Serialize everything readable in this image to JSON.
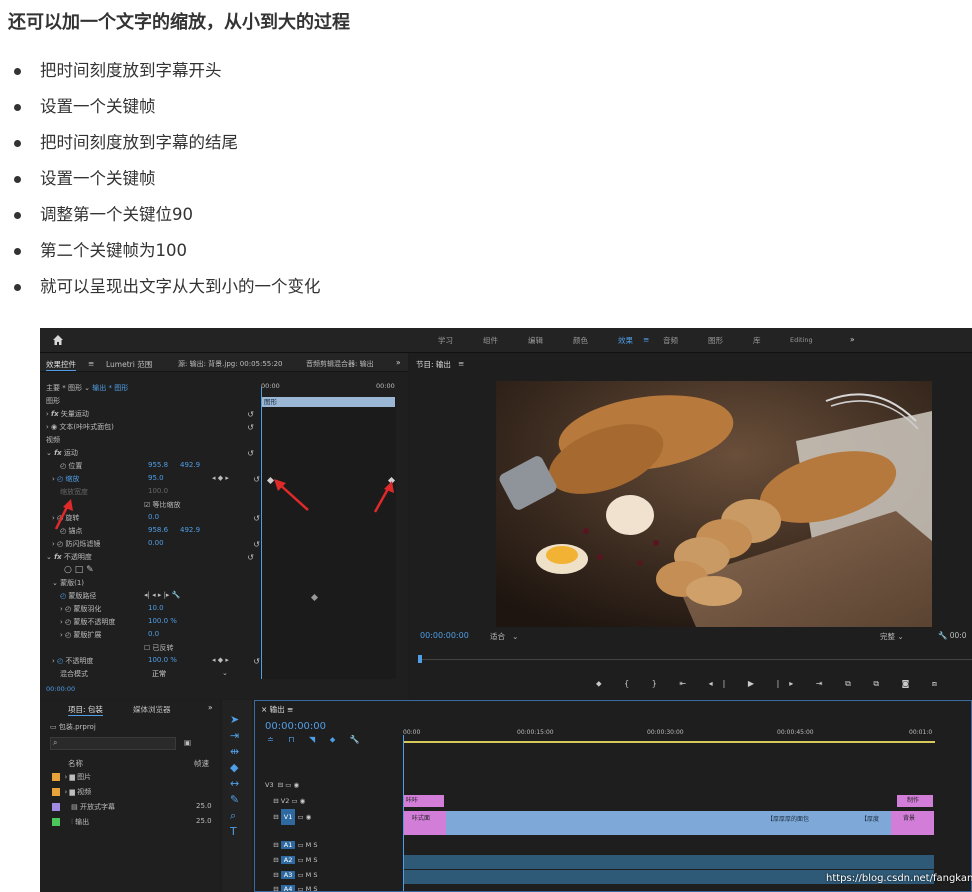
{
  "heading": "还可以加一个文字的缩放，从小到大的过程",
  "bullets": [
    "把时间刻度放到字幕开头",
    "设置一个关键帧",
    "把时间刻度放到字幕的结尾",
    "设置一个关键帧",
    "调整第一个关键位90",
    "第二个关键帧为100",
    "就可以呈现出文字从大到小的一个变化"
  ],
  "premiere": {
    "workspaces": [
      "学习",
      "组件",
      "编辑",
      "颜色",
      "效果",
      "音频",
      "图形",
      "库",
      "Editing"
    ],
    "active_workspace": "效果",
    "more": "»",
    "effect_controls": {
      "tabs": [
        "效果控件",
        "Lumetri 范围",
        "源: 输出: 背景.jpg: 00:05:55:20",
        "音频剪辑混合器: 输出"
      ],
      "source_label": "主要 * 图形",
      "seq_label": "输出 * 图形",
      "ruler_start": "00:00",
      "ruler_end": "00:00",
      "clip_label": "图形",
      "rows": [
        {
          "label": "图形"
        },
        {
          "label": "矢量运动"
        },
        {
          "label": "文本(咔咔式面包)"
        },
        {
          "label": "视频"
        },
        {
          "label": "运动"
        },
        {
          "label": "位置",
          "v1": "955.8",
          "v2": "492.9"
        },
        {
          "label": "缩放",
          "v1": "95.0"
        },
        {
          "label": "缩放宽度",
          "v1": "100.0"
        },
        {
          "label": "等比缩放"
        },
        {
          "label": "旋转",
          "v1": "0.0"
        },
        {
          "label": "锚点",
          "v1": "958.6",
          "v2": "492.9"
        },
        {
          "label": "防闪烁滤镜",
          "v1": "0.00"
        },
        {
          "label": "不透明度"
        },
        {
          "label": "蒙版(1)"
        },
        {
          "label": "蒙版路径"
        },
        {
          "label": "蒙版羽化",
          "v1": "10.0"
        },
        {
          "label": "蒙版不透明度",
          "v1": "100.0 %"
        },
        {
          "label": "蒙版扩展",
          "v1": "0.0"
        },
        {
          "label": "已反转"
        },
        {
          "label": "不透明度",
          "v1": "100.0 %"
        },
        {
          "label": "混合模式",
          "v1": "正常"
        }
      ],
      "timecode": "00:00:00"
    },
    "program": {
      "title": "节目: 输出",
      "timecode": "00:00:00:00",
      "fit": "适合",
      "quality": "完整",
      "end_tc": "00:0"
    },
    "project": {
      "tabs": [
        "项目: 包装",
        "媒体浏览器"
      ],
      "file": "包装.prproj",
      "col_name": "名称",
      "col_rate": "帧速",
      "items": [
        {
          "name": "图片",
          "color": "#e8a23a",
          "rate": ""
        },
        {
          "name": "视频",
          "color": "#e8a23a",
          "rate": ""
        },
        {
          "name": "开放式字幕",
          "color": "#9f8be0",
          "rate": "25.0"
        },
        {
          "name": "输出",
          "color": "#4cc65a",
          "rate": "25.0"
        }
      ]
    },
    "timeline": {
      "title": "输出",
      "timecode": "00:00:00:00",
      "ruler": [
        "00:00",
        "00:00:15:00",
        "00:00:30:00",
        "00:00:45:00",
        "00:01:0"
      ],
      "tracks": [
        "V3",
        "V2",
        "V1",
        "A1",
        "A2",
        "A3",
        "A4"
      ],
      "clips": {
        "v2_left": "咔咔",
        "v2_right": "制作",
        "v1_first": "咔式面",
        "v1_mid1": "【厚厚厚的面包",
        "v1_mid2": "【厚度",
        "v1_last": "背景"
      }
    }
  },
  "watermark": "https://blog.csdn.net/fangkang7"
}
